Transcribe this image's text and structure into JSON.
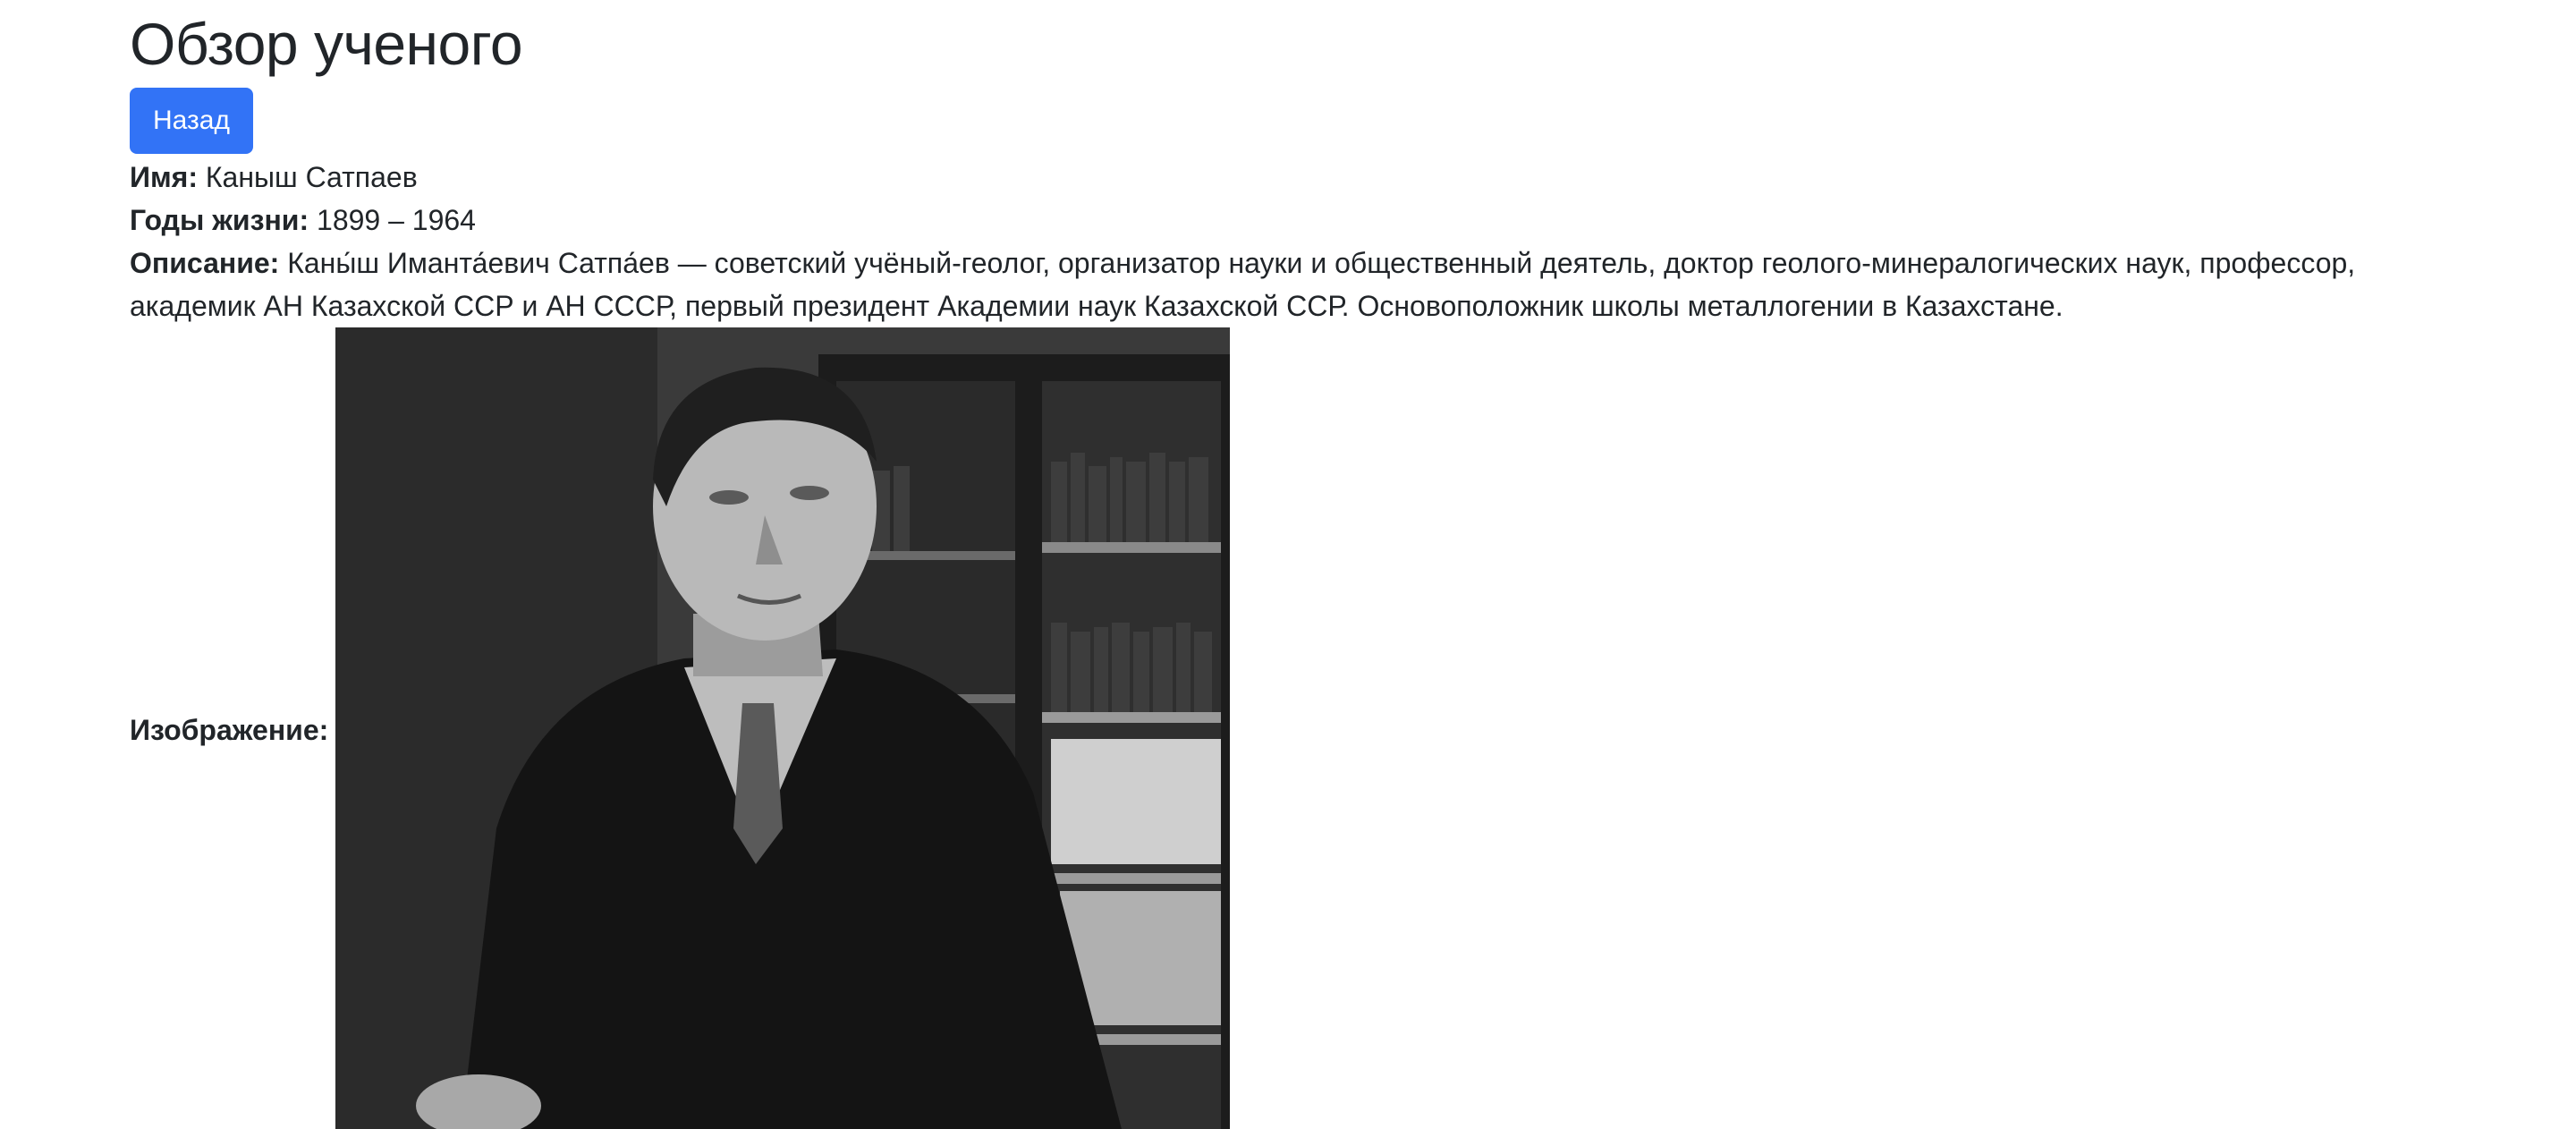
{
  "header": {
    "title": "Обзор ученого"
  },
  "actions": {
    "back_label": "Назад"
  },
  "scientist": {
    "name_label": "Имя:",
    "name_value": "Каныш Сатпаев",
    "years_label": "Годы жизни:",
    "years_value": "1899 – 1964",
    "description_label": "Описание:",
    "description_value": "Каны́ш Иманта́евич Сатпа́ев — советский учёный-геолог, организатор науки и общественный деятель, доктор геолого-минералогических наук, профессор, академик АН Казахской ССР и АН СССР, первый президент Академии наук Казахской ССР. Основоположник школы металлогении в Казахстане.",
    "image_label": "Изображение:"
  }
}
